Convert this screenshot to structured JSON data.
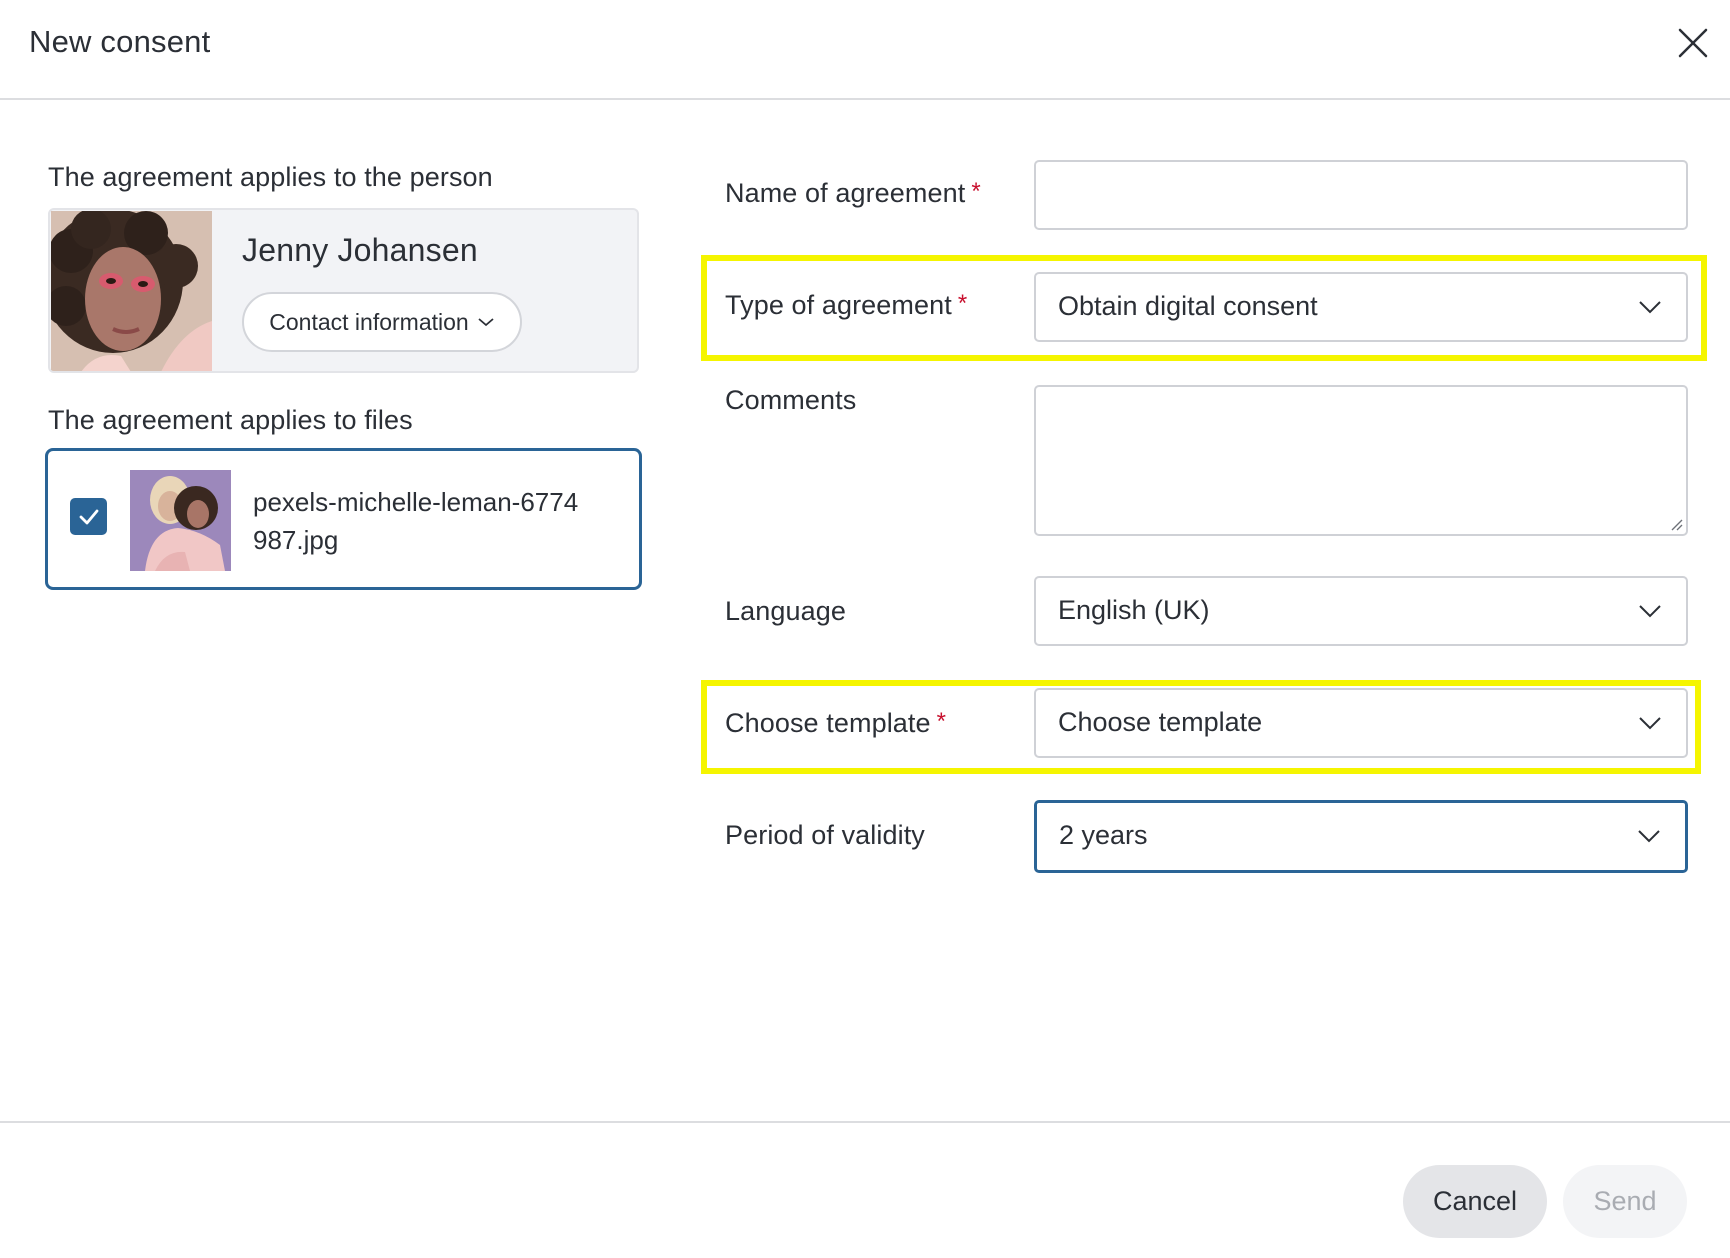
{
  "dialog": {
    "title": "New consent"
  },
  "person_section": {
    "label": "The agreement applies to the person",
    "name": "Jenny Johansen",
    "contact_button": "Contact information"
  },
  "files_section": {
    "label": "The agreement applies to files",
    "file": {
      "name": "pexels-michelle-leman-6774987.jpg",
      "checked": true
    }
  },
  "form": {
    "name_of_agreement": {
      "label": "Name of agreement",
      "required_mark": "*",
      "value": ""
    },
    "type_of_agreement": {
      "label": "Type of agreement",
      "required_mark": "*",
      "value": "Obtain digital consent"
    },
    "comments": {
      "label": "Comments",
      "value": ""
    },
    "language": {
      "label": "Language",
      "value": "English (UK)"
    },
    "choose_template": {
      "label": "Choose template",
      "required_mark": "*",
      "value": "Choose template"
    },
    "period_of_validity": {
      "label": "Period of validity",
      "value": "2 years"
    }
  },
  "footer": {
    "cancel_label": "Cancel",
    "send_label": "Send"
  },
  "colors": {
    "accent": "#2a6496",
    "required": "#c8102e",
    "highlight": "#f5f500"
  }
}
